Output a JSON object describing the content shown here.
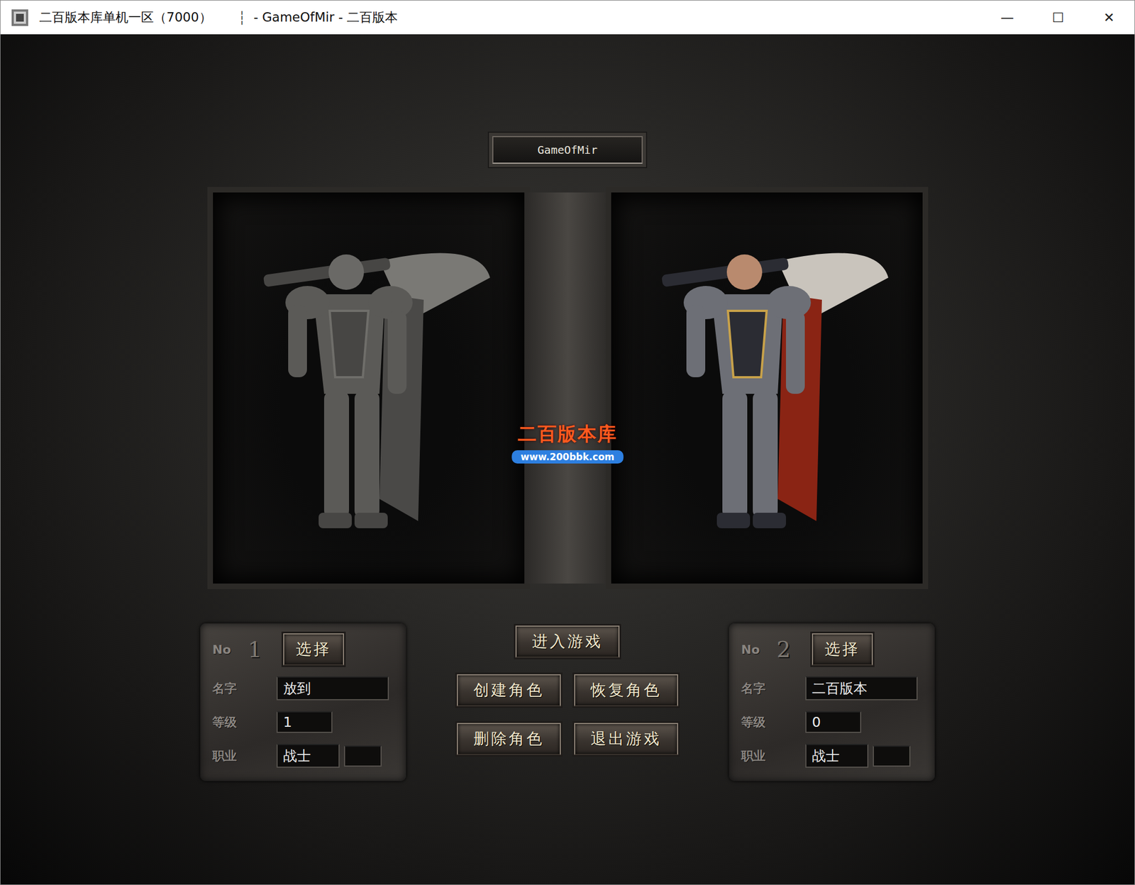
{
  "window": {
    "title": "二百版本库单机一区（7000）",
    "separator": "┆",
    "subtitle": "- GameOfMir - 二百版本",
    "controls": [
      "—",
      "☐",
      "✕"
    ]
  },
  "server": {
    "name": "GameOfMir"
  },
  "watermark": {
    "name": "二百版本库",
    "url": "www.200bbk.com"
  },
  "no_label": "No",
  "slots": [
    {
      "number": "1",
      "selected": false,
      "select_label": "选择",
      "fields": [
        {
          "kind": "name",
          "label": "名字",
          "value": "放到"
        },
        {
          "kind": "level",
          "label": "等级",
          "value": "1"
        },
        {
          "kind": "job",
          "label": "职业",
          "value": "战士"
        }
      ]
    },
    {
      "number": "2",
      "selected": true,
      "select_label": "选择",
      "fields": [
        {
          "kind": "name",
          "label": "名字",
          "value": "二百版本"
        },
        {
          "kind": "level",
          "label": "等级",
          "value": "0"
        },
        {
          "kind": "job",
          "label": "职业",
          "value": "战士"
        }
      ]
    }
  ],
  "actions": [
    [
      "进入游戏"
    ],
    [
      "创建角色",
      "恢复角色"
    ],
    [
      "删除角色",
      "退出游戏"
    ]
  ]
}
